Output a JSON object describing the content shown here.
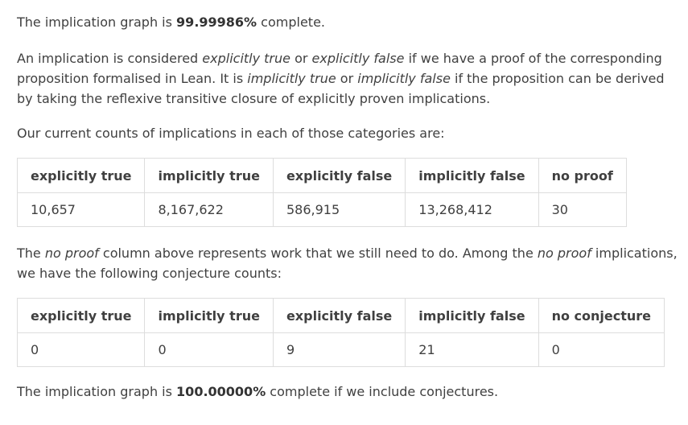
{
  "summary": {
    "prefix": "The implication graph is ",
    "percent": "99.99986%",
    "suffix": " complete."
  },
  "definition": {
    "t1": "An implication is considered ",
    "em1": "explicitly true",
    "t2": " or ",
    "em2": "explicitly false",
    "t3": " if we have a proof of the corresponding proposition formalised in Lean. It is ",
    "em3": "implicitly true",
    "t4": " or ",
    "em4": "implicitly false",
    "t5": " if the proposition can be derived by taking the reflexive transitive closure of explicitly proven implications."
  },
  "counts_intro": "Our current counts of implications in each of those categories are:",
  "counts_table": {
    "headers": [
      "explicitly true",
      "implicitly true",
      "explicitly false",
      "implicitly false",
      "no proof"
    ],
    "values": [
      "10,657",
      "8,167,622",
      "586,915",
      "13,268,412",
      "30"
    ]
  },
  "no_proof_note": {
    "t1": "The ",
    "em1": "no proof",
    "t2": " column above represents work that we still need to do. Among the ",
    "em2": "no proof",
    "t3": " implications, we have the following conjecture counts:"
  },
  "conjecture_table": {
    "headers": [
      "explicitly true",
      "implicitly true",
      "explicitly false",
      "implicitly false",
      "no conjecture"
    ],
    "values": [
      "0",
      "0",
      "9",
      "21",
      "0"
    ]
  },
  "conjecture_summary": {
    "prefix": "The implication graph is ",
    "percent": "100.00000%",
    "suffix": " complete if we include conjectures."
  }
}
